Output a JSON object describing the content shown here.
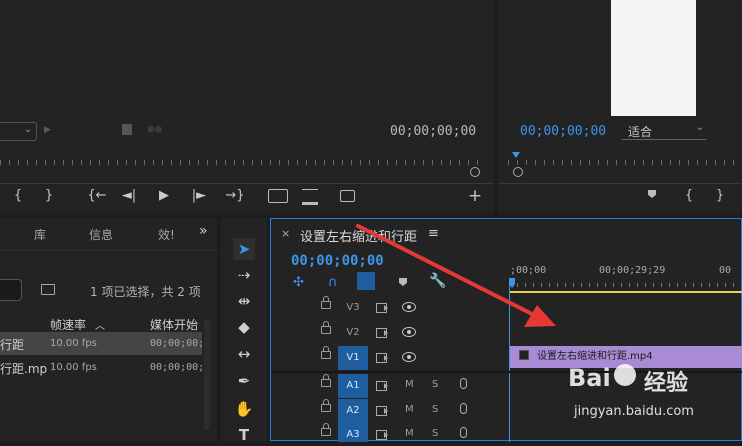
{
  "source_monitor": {
    "timecode": "00;00;00;00",
    "controls": [
      "{",
      "}",
      "{←",
      "◄|",
      "▶",
      "|►",
      "→}",
      "insert",
      "overwrite",
      "camera",
      "+"
    ]
  },
  "program_monitor": {
    "timecode": "00;00;00;00",
    "fit_select": "适合",
    "controls": [
      "marker",
      "{",
      "}",
      "{←"
    ]
  },
  "project_panel": {
    "tabs": [
      "库",
      "信息",
      "效!"
    ],
    "more": "»",
    "selection_status": "1 项已选择，共 2 项",
    "columns": [
      "帧速率",
      "媒体开始"
    ],
    "rows": [
      {
        "name": "行距",
        "fps": "10.00 fps",
        "start": "00;00;00;0"
      },
      {
        "name": "行距.mp",
        "fps": "10.00 fps",
        "start": "00;00;00;0"
      }
    ]
  },
  "timeline": {
    "close": "×",
    "sequence_name": "设置左右缩进和行距",
    "menu": "≡",
    "timecode": "00;00;00;00",
    "ruler_labels": [
      ";00;00",
      "00;00;29;29",
      "00"
    ],
    "video_tracks": [
      "V3",
      "V2",
      "V1"
    ],
    "audio_tracks": [
      "A1",
      "A2",
      "A3"
    ],
    "mute_label": "M",
    "solo_label": "S",
    "clip": {
      "name": "设置左右缩进和行距.mp4",
      "color": "#a98ad4"
    }
  },
  "watermark": {
    "line1": "Bai",
    "line2": "经验",
    "url": "jingyan.baidu.com"
  },
  "annotation_color": "#e53935"
}
